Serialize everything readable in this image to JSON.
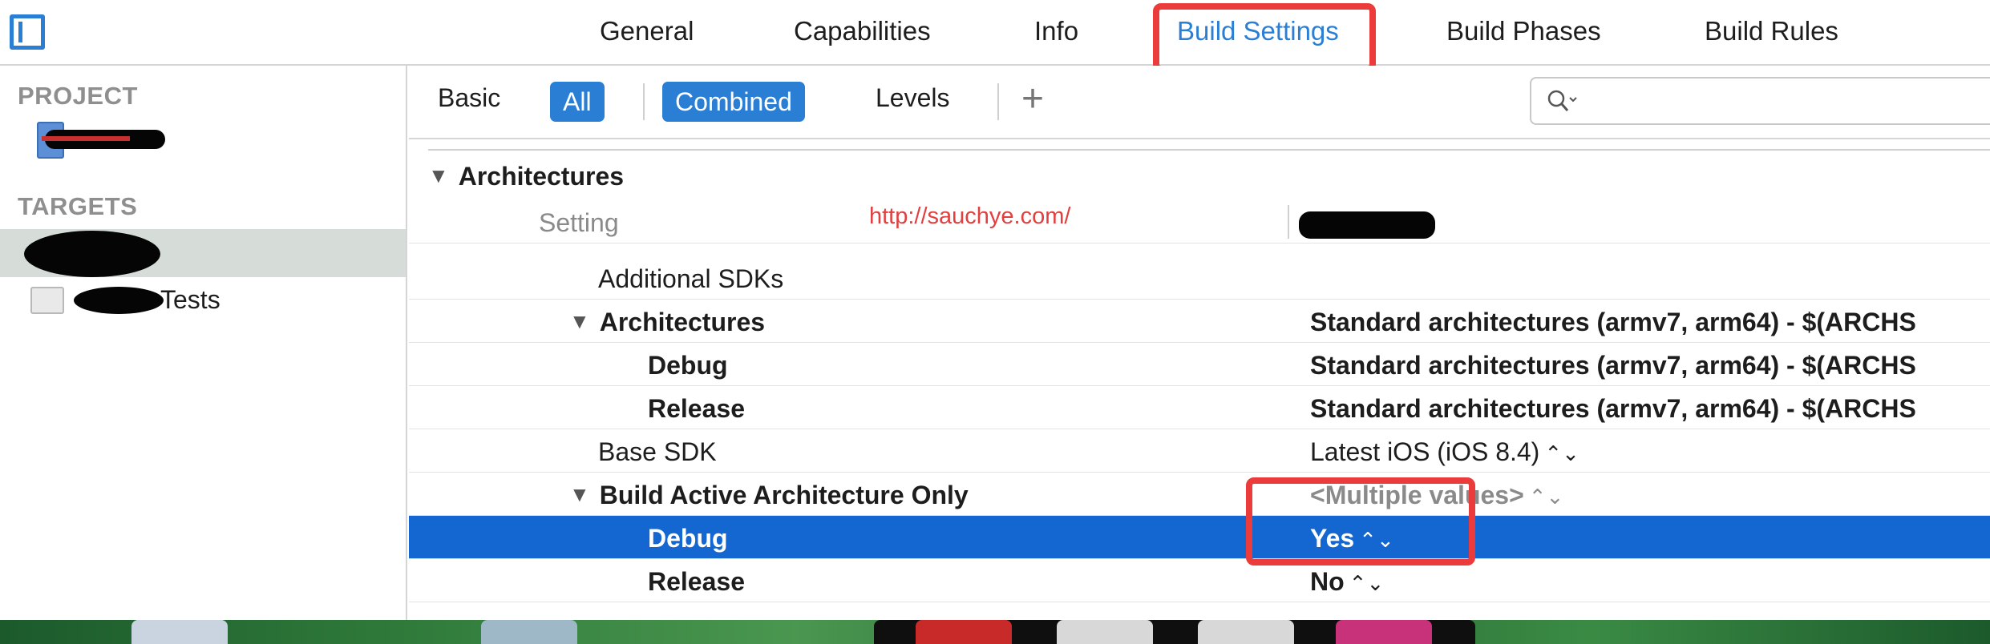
{
  "top_tabs": [
    {
      "label": "General"
    },
    {
      "label": "Capabilities"
    },
    {
      "label": "Info"
    },
    {
      "label": "Build Settings"
    },
    {
      "label": "Build Phases"
    },
    {
      "label": "Build Rules"
    }
  ],
  "active_tab": "Build Settings",
  "sidebar": {
    "project_header": "PROJECT",
    "targets_header": "TARGETS",
    "test_target_suffix": "Tests"
  },
  "filter_bar": {
    "basic": "Basic",
    "all": "All",
    "combined": "Combined",
    "levels": "Levels",
    "add": "+",
    "search_placeholder": ""
  },
  "section_title": "Architectures",
  "watermark_url": "http://sauchye.com/",
  "table": {
    "header_setting": "Setting",
    "rows": [
      {
        "name": "Additional SDKs",
        "value": ""
      },
      {
        "name": "Architectures",
        "value": "Standard architectures (armv7, arm64)  -  $(ARCHS"
      },
      {
        "name": "Debug",
        "value": "Standard architectures (armv7, arm64)  -  $(ARCHS"
      },
      {
        "name": "Release",
        "value": "Standard architectures (armv7, arm64)  -  $(ARCHS"
      },
      {
        "name": "Base SDK",
        "value": "Latest iOS (iOS 8.4)"
      },
      {
        "name": "Build Active Architecture Only",
        "value": "<Multiple values>"
      },
      {
        "name": "Debug",
        "value": "Yes"
      },
      {
        "name": "Release",
        "value": "No"
      }
    ]
  },
  "stepper_glyph": "⌃⌄",
  "colors": {
    "accent": "#2a7fd4",
    "selection": "#1466d0",
    "highlight_box": "#ec3b3b",
    "watermark": "#e04040"
  }
}
